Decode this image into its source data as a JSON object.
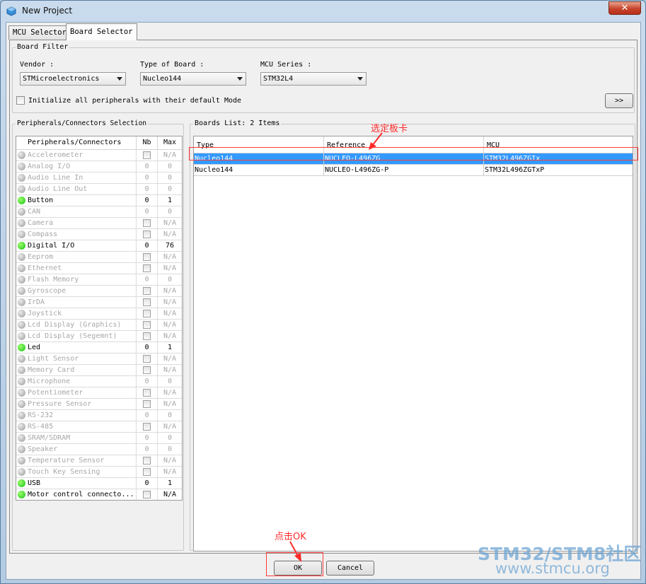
{
  "window": {
    "title": "New Project",
    "close_glyph": "✕"
  },
  "tabs": [
    {
      "label": "MCU Selector",
      "active": false
    },
    {
      "label": "Board Selector",
      "active": true
    }
  ],
  "board_filter": {
    "title": "Board Filter",
    "vendor": {
      "label": "Vendor :",
      "value": "STMicroelectronics"
    },
    "board_type": {
      "label": "Type of Board :",
      "value": "Nucleo144"
    },
    "mcu_series": {
      "label": "MCU Series :",
      "value": "STM32L4"
    },
    "init_checkbox_label": "Initialize all peripherals with their default Mode",
    "expand_label": ">>"
  },
  "peripherals": {
    "title": "Peripherals/Connectors Selection",
    "columns": [
      "Peripherals/Connectors",
      "Nb",
      "Max"
    ],
    "rows": [
      {
        "name": "Accelerometer",
        "nb": "",
        "max": "N/A",
        "active": false,
        "chk": true
      },
      {
        "name": "Analog I/O",
        "nb": "0",
        "max": "0",
        "active": false,
        "chk": false
      },
      {
        "name": "Audio Line In",
        "nb": "0",
        "max": "0",
        "active": false,
        "chk": false
      },
      {
        "name": "Audio Line Out",
        "nb": "0",
        "max": "0",
        "active": false,
        "chk": false
      },
      {
        "name": "Button",
        "nb": "0",
        "max": "1",
        "active": true,
        "chk": false
      },
      {
        "name": "CAN",
        "nb": "0",
        "max": "0",
        "active": false,
        "chk": false
      },
      {
        "name": "Camera",
        "nb": "",
        "max": "N/A",
        "active": false,
        "chk": true
      },
      {
        "name": "Compass",
        "nb": "",
        "max": "N/A",
        "active": false,
        "chk": true
      },
      {
        "name": "Digital I/O",
        "nb": "0",
        "max": "76",
        "active": true,
        "chk": false
      },
      {
        "name": "Eeprom",
        "nb": "",
        "max": "N/A",
        "active": false,
        "chk": true
      },
      {
        "name": "Ethernet",
        "nb": "",
        "max": "N/A",
        "active": false,
        "chk": true
      },
      {
        "name": "Flash Memory",
        "nb": "0",
        "max": "0",
        "active": false,
        "chk": false
      },
      {
        "name": "Gyroscope",
        "nb": "",
        "max": "N/A",
        "active": false,
        "chk": true
      },
      {
        "name": "IrDA",
        "nb": "",
        "max": "N/A",
        "active": false,
        "chk": true
      },
      {
        "name": "Joystick",
        "nb": "",
        "max": "N/A",
        "active": false,
        "chk": true
      },
      {
        "name": "Lcd Display (Graphics)",
        "nb": "",
        "max": "N/A",
        "active": false,
        "chk": true
      },
      {
        "name": "Lcd Display (Segemnt)",
        "nb": "",
        "max": "N/A",
        "active": false,
        "chk": true
      },
      {
        "name": "Led",
        "nb": "0",
        "max": "1",
        "active": true,
        "chk": false
      },
      {
        "name": "Light Sensor",
        "nb": "",
        "max": "N/A",
        "active": false,
        "chk": true
      },
      {
        "name": "Memory Card",
        "nb": "",
        "max": "N/A",
        "active": false,
        "chk": true
      },
      {
        "name": "Microphone",
        "nb": "0",
        "max": "0",
        "active": false,
        "chk": false
      },
      {
        "name": "Potentiometer",
        "nb": "",
        "max": "N/A",
        "active": false,
        "chk": true
      },
      {
        "name": "Pressure Sensor",
        "nb": "",
        "max": "N/A",
        "active": false,
        "chk": true
      },
      {
        "name": "RS-232",
        "nb": "0",
        "max": "0",
        "active": false,
        "chk": false
      },
      {
        "name": "RS-485",
        "nb": "",
        "max": "N/A",
        "active": false,
        "chk": true
      },
      {
        "name": "SRAM/SDRAM",
        "nb": "0",
        "max": "0",
        "active": false,
        "chk": false
      },
      {
        "name": "Speaker",
        "nb": "0",
        "max": "0",
        "active": false,
        "chk": false
      },
      {
        "name": "Temperature Sensor",
        "nb": "",
        "max": "N/A",
        "active": false,
        "chk": true
      },
      {
        "name": "Touch Key Sensing",
        "nb": "",
        "max": "N/A",
        "active": false,
        "chk": true
      },
      {
        "name": "USB",
        "nb": "0",
        "max": "1",
        "active": true,
        "chk": false
      },
      {
        "name": "Motor control connecto...",
        "nb": "",
        "max": "N/A",
        "active": true,
        "chk": true
      }
    ]
  },
  "boards": {
    "title": "Boards List: 2 Items",
    "columns": [
      "Type",
      "Reference",
      "MCU"
    ],
    "rows": [
      {
        "type": "Nucleo144",
        "reference": "NUCLEO-L496ZG",
        "mcu": "STM32L496ZGIx",
        "selected": true
      },
      {
        "type": "Nucleo144",
        "reference": "NUCLEO-L496ZG-P",
        "mcu": "STM32L496ZGTxP",
        "selected": false
      }
    ]
  },
  "annotations": {
    "select_board": "选定板卡",
    "click_ok": "点击OK"
  },
  "footer": {
    "ok_label": "OK",
    "cancel_label": "Cancel"
  },
  "watermark": {
    "line1": "STM32/STM8社区",
    "line2": "www.stmcu.org"
  },
  "colors": {
    "selection": "#3399ff",
    "annotation": "#ff2a2a",
    "active_dot": "#18c018"
  }
}
